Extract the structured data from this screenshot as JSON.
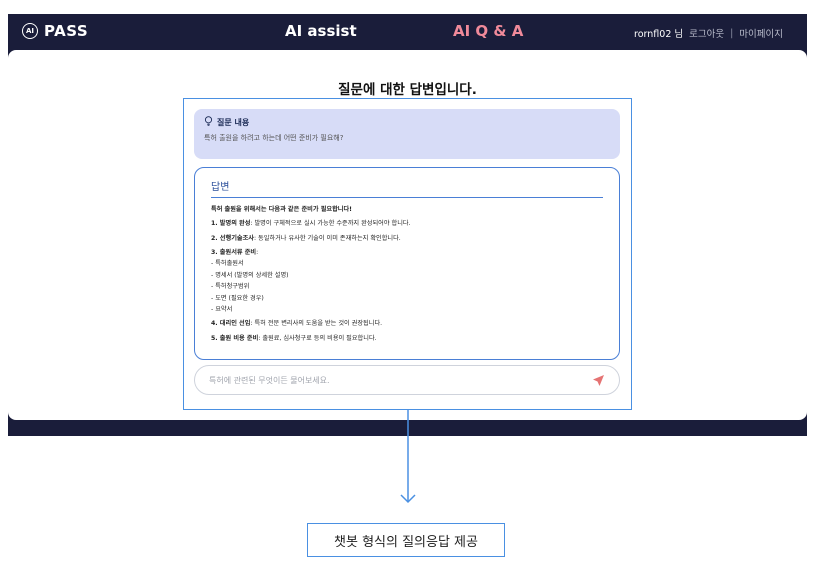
{
  "header": {
    "logo_text": "PASS",
    "logo_badge": "AI",
    "nav_assist": "AI assist",
    "nav_qa": "AI Q & A",
    "username": "rornfl02 님",
    "logout": "로그아웃",
    "separator": "|",
    "mypage": "마이페이지"
  },
  "page": {
    "title": "질문에 대한 답변입니다."
  },
  "question": {
    "label": "질문 내용",
    "text": "특허 출원을 하려고 하는데 어떤 준비가 필요해?"
  },
  "answer": {
    "label": "답변",
    "intro": "특허 출원을 위해서는 다음과 같은 준비가 필요합니다!",
    "items": [
      {
        "head": "1. 발명의 완성",
        "body": ": 발명이 구체적으로 실시 가능한 수준까지 완성되어야 합니다."
      },
      {
        "head": "2. 선행기술조사",
        "body": ": 동일하거나 유사한 기술이 이미 존재하는지 확인합니다."
      },
      {
        "head": "3. 출원서류 준비",
        "body": ":"
      },
      {
        "head": "4. 대리인 선임",
        "body": ": 특허 전문 변리사의 도움을 받는 것이 권장됩니다."
      },
      {
        "head": "5. 출원 비용 준비",
        "body": ": 출원료, 심사청구료 등의 비용이 필요합니다."
      }
    ],
    "documents": [
      "- 특허출원서",
      "- 명세서 (발명의 상세한 설명)",
      "- 특허청구범위",
      "- 도면 (필요한 경우)",
      "- 요약서"
    ]
  },
  "input": {
    "placeholder": "특허에 관련된 무엇이든 물어보세요."
  },
  "caption": "챗봇 형식의 질의응답 제공",
  "colors": {
    "frame": "#1a1d3a",
    "accent_pink": "#f08a9a",
    "highlight_blue": "#4a90e2",
    "question_bg": "#d7dcf7",
    "send_icon": "#e57373"
  }
}
